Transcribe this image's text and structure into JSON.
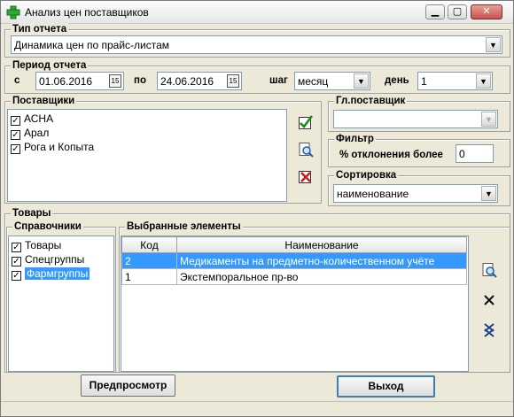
{
  "window": {
    "title": "Анализ цен поставщиков"
  },
  "report_type": {
    "label": "Тип отчета",
    "selected": "Динамика цен по прайс-листам"
  },
  "period": {
    "label": "Период отчета",
    "from_label": "с",
    "from_value": "01.06.2016",
    "to_label": "по",
    "to_value": "24.06.2016",
    "step_label": "шаг",
    "step_value": "месяц",
    "day_label": "день",
    "day_value": "1"
  },
  "suppliers": {
    "label": "Поставщики",
    "items": [
      {
        "label": "АСНА",
        "checked": true
      },
      {
        "label": "Арал",
        "checked": true
      },
      {
        "label": "Рога и Копыта",
        "checked": true
      }
    ]
  },
  "main_supplier": {
    "label": "Гл.поставщик",
    "selected": ""
  },
  "filter": {
    "label": "Фильтр",
    "deviation_label": "% отклонения более",
    "deviation_value": "0"
  },
  "sorting": {
    "label": "Сортировка",
    "selected": "наименование"
  },
  "goods": {
    "label": "Товары",
    "directories": {
      "label": "Справочники",
      "items": [
        {
          "label": "Товары",
          "checked": true
        },
        {
          "label": "Спецгруппы",
          "checked": true
        },
        {
          "label": "Фармгруппы",
          "checked": true,
          "selected": true
        }
      ]
    },
    "selected_elements": {
      "label": "Выбранные элементы",
      "columns": [
        "Код",
        "Наименование"
      ],
      "rows": [
        {
          "code": "2",
          "name": "Медикаменты на предметно-количественном учёте",
          "selected": true
        },
        {
          "code": "1",
          "name": "Экстемпоральное пр-во",
          "selected": false
        }
      ]
    }
  },
  "buttons": {
    "preview": "Предпросмотр",
    "exit": "Выход"
  }
}
